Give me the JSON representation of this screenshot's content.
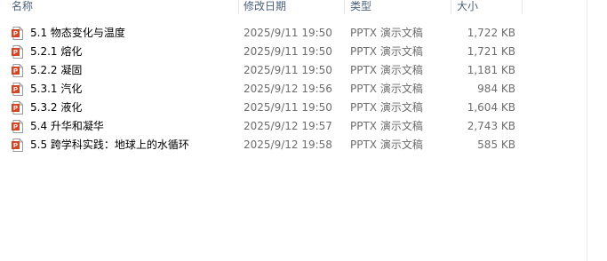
{
  "columns": {
    "name": "名称",
    "date": "修改日期",
    "type": "类型",
    "size": "大小"
  },
  "files": [
    {
      "name": "5.1 物态变化与温度",
      "date": "2025/9/11 19:50",
      "type": "PPTX 演示文稿",
      "size": "1,722 KB",
      "icon": "pptx-file-icon"
    },
    {
      "name": "5.2.1 熔化",
      "date": "2025/9/11 19:50",
      "type": "PPTX 演示文稿",
      "size": "1,721 KB",
      "icon": "pptx-file-icon"
    },
    {
      "name": "5.2.2 凝固",
      "date": "2025/9/11 19:50",
      "type": "PPTX 演示文稿",
      "size": "1,181 KB",
      "icon": "pptx-file-icon"
    },
    {
      "name": "5.3.1 汽化",
      "date": "2025/9/12 19:56",
      "type": "PPTX 演示文稿",
      "size": "984 KB",
      "icon": "pptx-file-icon"
    },
    {
      "name": "5.3.2 液化",
      "date": "2025/9/11 19:50",
      "type": "PPTX 演示文稿",
      "size": "1,604 KB",
      "icon": "pptx-file-icon"
    },
    {
      "name": "5.4 升华和凝华",
      "date": "2025/9/12 19:57",
      "type": "PPTX 演示文稿",
      "size": "2,743 KB",
      "icon": "pptx-file-icon"
    },
    {
      "name": "5.5 跨学科实践：地球上的水循环",
      "date": "2025/9/12 19:58",
      "type": "PPTX 演示文稿",
      "size": "585 KB",
      "icon": "pptx-file-icon"
    }
  ],
  "colors": {
    "header_text": "#4c607a",
    "detail_text": "#6d6d6d",
    "icon_orange": "#d24625"
  }
}
